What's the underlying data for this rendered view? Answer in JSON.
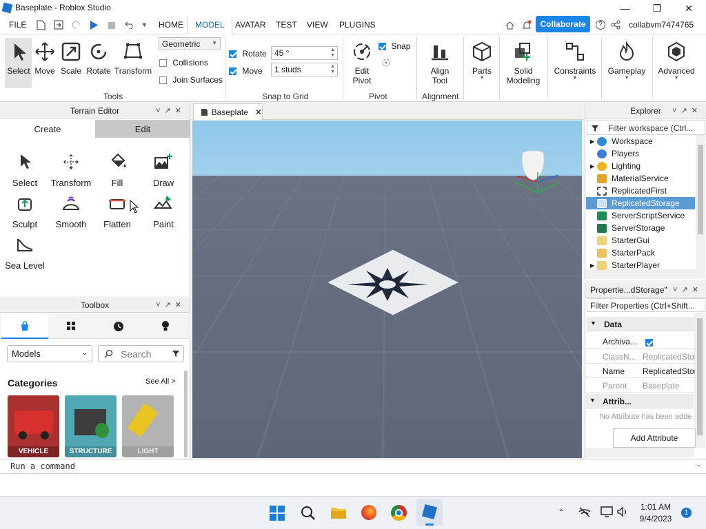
{
  "window": {
    "title": "Baseplate - Roblox Studio",
    "controls": [
      "minimize",
      "maximize",
      "close"
    ]
  },
  "menu": {
    "file": "FILE",
    "tabs": [
      "HOME",
      "MODEL",
      "AVATAR",
      "TEST",
      "VIEW",
      "PLUGINS"
    ],
    "active_tab": "MODEL",
    "collaborate": "Collaborate",
    "username": "collabvm7474765"
  },
  "ribbon": {
    "tools": [
      "Select",
      "Move",
      "Scale",
      "Rotate",
      "Transform"
    ],
    "tools_group": "Tools",
    "geometric": "Geometric",
    "collisions": "Collisions",
    "join_surfaces": "Join Surfaces",
    "rotate_label": "Rotate",
    "rotate_value": "45 °",
    "move_label": "Move",
    "move_value": "1 studs",
    "snap_group": "Snap to Grid",
    "edit_pivot": [
      "Edit",
      "Pivot"
    ],
    "snap": "Snap",
    "pivot_group": "Pivot",
    "align_tool": [
      "Align",
      "Tool"
    ],
    "alignment_group": "Alignment",
    "parts": "Parts",
    "solid_modeling": [
      "Solid",
      "Modeling"
    ],
    "constraints": "Constraints",
    "gameplay": "Gameplay",
    "advanced": "Advanced"
  },
  "terrain": {
    "title": "Terrain Editor",
    "tab_create": "Create",
    "tab_edit": "Edit",
    "tools": [
      "Select",
      "Transform",
      "Fill",
      "Draw",
      "Sculpt",
      "Smooth",
      "Flatten",
      "Paint",
      "Sea Level"
    ]
  },
  "toolbox": {
    "title": "Toolbox",
    "category_select": "Models",
    "search_placeholder": "Search",
    "categories_label": "Categories",
    "see_all": "See All >",
    "cards": [
      "VEHICLE",
      "STRUCTURE",
      "LIGHT"
    ]
  },
  "viewport": {
    "tab": "Baseplate"
  },
  "explorer": {
    "title": "Explorer",
    "filter_placeholder": "Filter workspace (Ctrl...",
    "items": [
      "Workspace",
      "Players",
      "Lighting",
      "MaterialService",
      "ReplicatedFirst",
      "ReplicatedStorage",
      "ServerScriptService",
      "ServerStorage",
      "StarterGui",
      "StarterPack",
      "StarterPlayer"
    ],
    "selected": "ReplicatedStorage"
  },
  "properties": {
    "title": "Propertie...dStorage\"",
    "filter_placeholder": "Filter Properties (Ctrl+Shift...",
    "data_section": "Data",
    "rows": [
      {
        "name": "Archiva...",
        "value": ""
      },
      {
        "name": "ClassN...",
        "value": "ReplicatedStor"
      },
      {
        "name": "Name",
        "value": "ReplicatedStor"
      },
      {
        "name": "Parent",
        "value": "Baseplate"
      }
    ],
    "attrib_section": "Attrib...",
    "no_attr": "No Attribute has been adde",
    "add_attribute": "Add Attribute"
  },
  "command": {
    "placeholder": "Run a command"
  },
  "taskbar": {
    "time": "1:01 AM",
    "date": "9/4/2023",
    "badge": "1"
  },
  "colors": {
    "accent": "#1a86e8",
    "selected_bg": "#5b9bd5",
    "sky": "#a9d3ef",
    "floor": "#6b7384"
  }
}
